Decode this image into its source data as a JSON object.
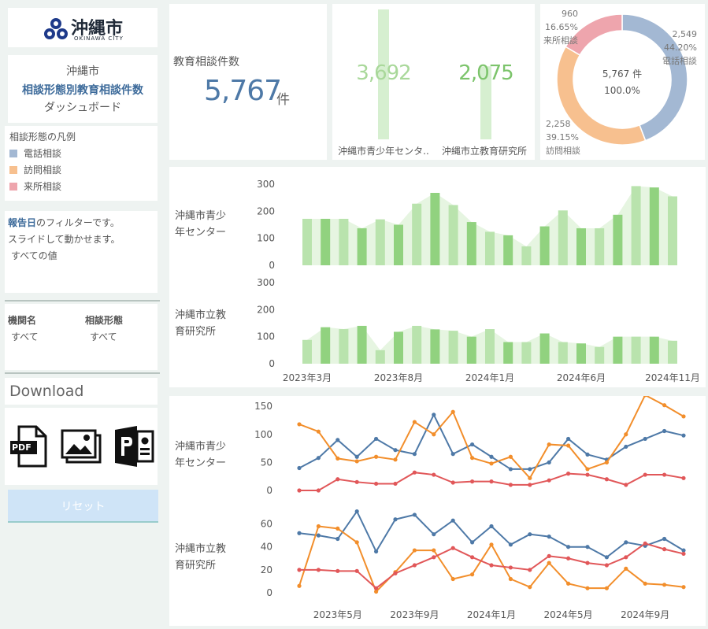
{
  "sidebar": {
    "logo_main": "沖縄市",
    "logo_sub": "OKINAWA CITY",
    "title_line1": "沖縄市",
    "title_line2": "相談形態別教育相談件数",
    "title_line3": "ダッシュボード",
    "legend_title": "相談形態の凡例",
    "legend_items": [
      {
        "label": "電話相談",
        "color": "#a3b8d3"
      },
      {
        "label": "訪問相談",
        "color": "#f7c08f"
      },
      {
        "label": "来所相談",
        "color": "#eea5ad"
      }
    ],
    "filter_strong": "報告日",
    "filter_text1": "のフィルターです。",
    "filter_text2": "スライドして動かせます。",
    "filter_value": "すべての値",
    "filter_org_label": "機関名",
    "filter_org_value": "すべて",
    "filter_type_label": "相談形態",
    "filter_type_value": "すべて",
    "download_label": "Download",
    "pdf_label": "PDF",
    "reset_label": "リセット"
  },
  "kpi": {
    "label": "教育相談件数",
    "value": "5,767",
    "unit": "件"
  },
  "chart_data": [
    {
      "type": "bar",
      "categories": [
        "沖縄市青少年センタ..",
        "沖縄市立教育研究所"
      ],
      "values": [
        3692,
        2075
      ],
      "value_labels": [
        "3,692",
        "2,075"
      ]
    },
    {
      "type": "pie",
      "center_label1": "5,767 件",
      "center_label2": "100.0%",
      "slices": [
        {
          "name": "電話相談",
          "value": 2549,
          "pct": "44.20%",
          "value_label": "2,549",
          "color": "#a3b8d3"
        },
        {
          "name": "訪問相談",
          "value": 2258,
          "pct": "39.15%",
          "value_label": "2,258",
          "color": "#f7c08f"
        },
        {
          "name": "来所相談",
          "value": 960,
          "pct": "16.65%",
          "value_label": "960",
          "color": "#eea5ad"
        }
      ]
    },
    {
      "type": "bar",
      "panels": [
        "沖縄市青少年センター",
        "沖縄市立教育研究所"
      ],
      "x_tick_labels": [
        "2023年3月",
        "2023年8月",
        "2024年1月",
        "2024年6月",
        "2024年11月"
      ],
      "series": [
        {
          "values": [
            172,
            172,
            172,
            137,
            170,
            150,
            228,
            268,
            223,
            160,
            124,
            111,
            70,
            144,
            203,
            137,
            137,
            187,
            293,
            288,
            255
          ],
          "yticks": [
            0,
            100,
            200,
            300
          ],
          "ylim": [
            0,
            300
          ]
        },
        {
          "values": [
            88,
            135,
            128,
            140,
            50,
            118,
            140,
            127,
            122,
            100,
            128,
            80,
            80,
            112,
            80,
            75,
            62,
            100,
            100,
            100,
            85
          ],
          "yticks": [
            0,
            100,
            200,
            300
          ],
          "ylim": [
            0,
            300
          ]
        }
      ]
    },
    {
      "type": "line",
      "panels": [
        "沖縄市青少年センター",
        "沖縄市立教育研究所"
      ],
      "x_tick_labels": [
        "2023年5月",
        "2023年9月",
        "2024年1月",
        "2024年5月",
        "2024年9月"
      ],
      "colors": {
        "電話相談": "#4e79a7",
        "訪問相談": "#f28e2b",
        "来所相談": "#e15759"
      },
      "groups": [
        {
          "yticks": [
            0,
            50,
            100,
            150
          ],
          "ylim": [
            0,
            160
          ],
          "series": [
            {
              "name": "電話相談",
              "values": [
                40,
                58,
                90,
                60,
                92,
                72,
                65,
                135,
                65,
                82,
                60,
                38,
                38,
                50,
                92,
                64,
                55,
                78,
                92,
                106,
                98
              ]
            },
            {
              "name": "訪問相談",
              "values": [
                118,
                105,
                57,
                52,
                60,
                55,
                122,
                100,
                140,
                58,
                48,
                60,
                22,
                82,
                80,
                38,
                50,
                100,
                170,
                152,
                132
              ]
            },
            {
              "name": "来所相談",
              "values": [
                0,
                0,
                20,
                15,
                12,
                12,
                32,
                28,
                14,
                16,
                16,
                10,
                10,
                18,
                30,
                28,
                20,
                10,
                28,
                28,
                22
              ]
            }
          ]
        },
        {
          "yticks": [
            0,
            20,
            40,
            60
          ],
          "ylim": [
            0,
            70
          ],
          "series": [
            {
              "name": "電話相談",
              "values": [
                52,
                50,
                47,
                71,
                36,
                64,
                68,
                51,
                63,
                44,
                58,
                42,
                51,
                49,
                40,
                40,
                31,
                44,
                41,
                47,
                37
              ]
            },
            {
              "name": "訪問相談",
              "values": [
                6,
                58,
                56,
                44,
                1,
                18,
                37,
                37,
                12,
                16,
                42,
                12,
                5,
                26,
                8,
                4,
                4,
                21,
                8,
                7,
                5
              ]
            },
            {
              "name": "来所相談",
              "values": [
                20,
                20,
                19,
                19,
                4,
                17,
                24,
                31,
                39,
                31,
                24,
                22,
                20,
                32,
                30,
                26,
                24,
                31,
                43,
                38,
                34
              ]
            }
          ]
        }
      ]
    }
  ]
}
